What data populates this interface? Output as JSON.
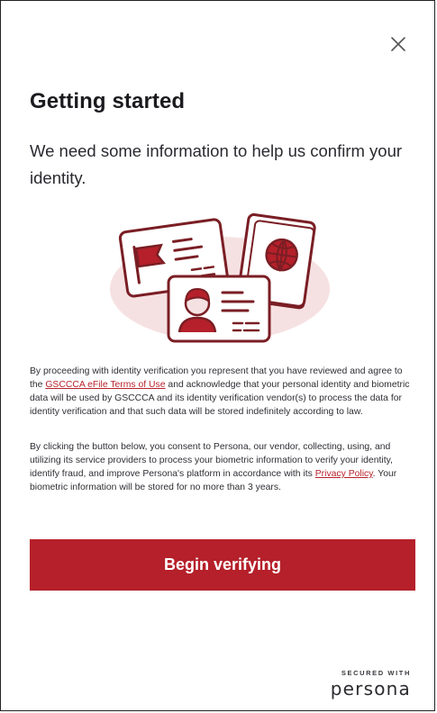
{
  "header": {
    "close_icon": "close-icon"
  },
  "main": {
    "title": "Getting started",
    "subtitle": "We need some information to help us confirm your identity.",
    "illustration_icon": "id-documents-illustration"
  },
  "legal": {
    "p1_before": "By proceeding with identity verification you represent that you have reviewed and agree to the ",
    "p1_link": "GSCCCA eFile Terms of Use",
    "p1_after": " and acknowledge that your personal identity and biometric data will be used by GSCCCA and its identity verification vendor(s) to process the data for identity verification and that such data will be stored indefinitely according to law.",
    "p2_before": "By clicking the button below, you consent to Persona, our vendor, collecting, using, and utilizing its service providers to process your biometric information to verify your identity, identify fraud, and improve Persona's platform in accordance with its ",
    "p2_link": "Privacy Policy",
    "p2_after": ". Your biometric information will be stored for no more than 3 years."
  },
  "actions": {
    "begin_label": "Begin verifying"
  },
  "footer": {
    "secured_label": "SECURED WITH",
    "brand": "persona"
  },
  "colors": {
    "accent": "#b5202a",
    "illustration_bg": "#f6e1e2",
    "illustration_line": "#7a1e24"
  }
}
